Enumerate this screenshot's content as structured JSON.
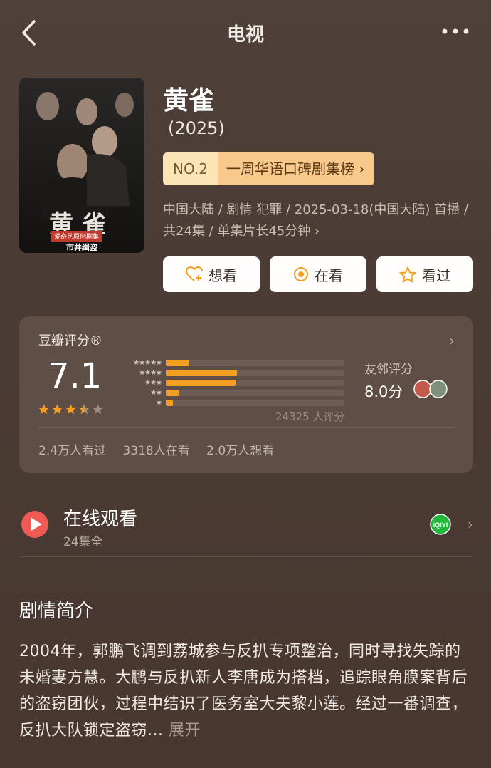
{
  "nav": {
    "title": "电视"
  },
  "show": {
    "title": "黄雀",
    "year": "(2025)",
    "rank_no": "NO.2",
    "rank_label": "一周华语口碑剧集榜 ›",
    "meta": "中国大陆 / 剧情 犯罪 / 2025-03-18(中国大陆) 首播 / 共24集 / 单集片长45分钟 ›",
    "poster_text": {
      "title": "黄雀",
      "subtitle": "爱奇艺原创剧集",
      "tagline": "市井缉盗"
    }
  },
  "actions": {
    "want": "想看",
    "watching": "在看",
    "watched": "看过"
  },
  "rating": {
    "title": "豆瓣评分®",
    "score": "7.1",
    "stars_value": 3.5,
    "distribution": [
      0.13,
      0.4,
      0.39,
      0.07,
      0.04
    ],
    "count": "24325 人评分",
    "friend_label": "友邻评分",
    "friend_score": "8.0分",
    "watched": "2.4万人看过",
    "watching": "3318人在看",
    "want": "2.0万人想看"
  },
  "watch": {
    "title": "在线观看",
    "subtitle": "24集全",
    "platform": "iQIYI"
  },
  "synopsis": {
    "title": "剧情简介",
    "text": "2004年，郭鹏飞调到荔城参与反扒专项整治，同时寻找失踪的未婚妻方慧。大鹏与反扒新人李唐成为搭档，追踪眼角膜案背后的盗窃团伙，过程中结识了医务室大夫黎小莲。经过一番调查，反扒大队锁定盗窃...",
    "expand": "展开"
  },
  "colors": {
    "accent": "#f49e22",
    "badge_bg": "#f8c98a",
    "iqiyi": "#22b83a"
  }
}
